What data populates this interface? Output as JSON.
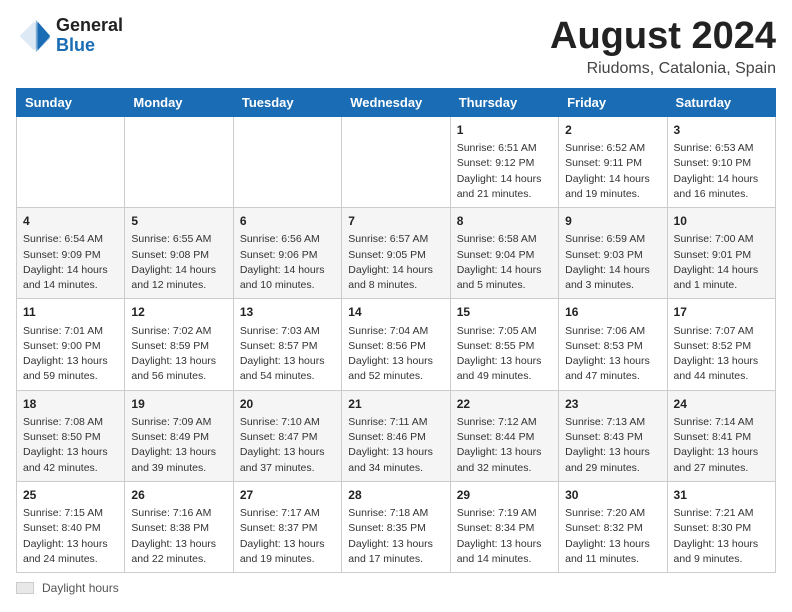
{
  "logo": {
    "general": "General",
    "blue": "Blue"
  },
  "header": {
    "month": "August 2024",
    "location": "Riudoms, Catalonia, Spain"
  },
  "weekdays": [
    "Sunday",
    "Monday",
    "Tuesday",
    "Wednesday",
    "Thursday",
    "Friday",
    "Saturday"
  ],
  "weeks": [
    [
      {
        "day": "",
        "info": ""
      },
      {
        "day": "",
        "info": ""
      },
      {
        "day": "",
        "info": ""
      },
      {
        "day": "",
        "info": ""
      },
      {
        "day": "1",
        "info": "Sunrise: 6:51 AM\nSunset: 9:12 PM\nDaylight: 14 hours and 21 minutes."
      },
      {
        "day": "2",
        "info": "Sunrise: 6:52 AM\nSunset: 9:11 PM\nDaylight: 14 hours and 19 minutes."
      },
      {
        "day": "3",
        "info": "Sunrise: 6:53 AM\nSunset: 9:10 PM\nDaylight: 14 hours and 16 minutes."
      }
    ],
    [
      {
        "day": "4",
        "info": "Sunrise: 6:54 AM\nSunset: 9:09 PM\nDaylight: 14 hours and 14 minutes."
      },
      {
        "day": "5",
        "info": "Sunrise: 6:55 AM\nSunset: 9:08 PM\nDaylight: 14 hours and 12 minutes."
      },
      {
        "day": "6",
        "info": "Sunrise: 6:56 AM\nSunset: 9:06 PM\nDaylight: 14 hours and 10 minutes."
      },
      {
        "day": "7",
        "info": "Sunrise: 6:57 AM\nSunset: 9:05 PM\nDaylight: 14 hours and 8 minutes."
      },
      {
        "day": "8",
        "info": "Sunrise: 6:58 AM\nSunset: 9:04 PM\nDaylight: 14 hours and 5 minutes."
      },
      {
        "day": "9",
        "info": "Sunrise: 6:59 AM\nSunset: 9:03 PM\nDaylight: 14 hours and 3 minutes."
      },
      {
        "day": "10",
        "info": "Sunrise: 7:00 AM\nSunset: 9:01 PM\nDaylight: 14 hours and 1 minute."
      }
    ],
    [
      {
        "day": "11",
        "info": "Sunrise: 7:01 AM\nSunset: 9:00 PM\nDaylight: 13 hours and 59 minutes."
      },
      {
        "day": "12",
        "info": "Sunrise: 7:02 AM\nSunset: 8:59 PM\nDaylight: 13 hours and 56 minutes."
      },
      {
        "day": "13",
        "info": "Sunrise: 7:03 AM\nSunset: 8:57 PM\nDaylight: 13 hours and 54 minutes."
      },
      {
        "day": "14",
        "info": "Sunrise: 7:04 AM\nSunset: 8:56 PM\nDaylight: 13 hours and 52 minutes."
      },
      {
        "day": "15",
        "info": "Sunrise: 7:05 AM\nSunset: 8:55 PM\nDaylight: 13 hours and 49 minutes."
      },
      {
        "day": "16",
        "info": "Sunrise: 7:06 AM\nSunset: 8:53 PM\nDaylight: 13 hours and 47 minutes."
      },
      {
        "day": "17",
        "info": "Sunrise: 7:07 AM\nSunset: 8:52 PM\nDaylight: 13 hours and 44 minutes."
      }
    ],
    [
      {
        "day": "18",
        "info": "Sunrise: 7:08 AM\nSunset: 8:50 PM\nDaylight: 13 hours and 42 minutes."
      },
      {
        "day": "19",
        "info": "Sunrise: 7:09 AM\nSunset: 8:49 PM\nDaylight: 13 hours and 39 minutes."
      },
      {
        "day": "20",
        "info": "Sunrise: 7:10 AM\nSunset: 8:47 PM\nDaylight: 13 hours and 37 minutes."
      },
      {
        "day": "21",
        "info": "Sunrise: 7:11 AM\nSunset: 8:46 PM\nDaylight: 13 hours and 34 minutes."
      },
      {
        "day": "22",
        "info": "Sunrise: 7:12 AM\nSunset: 8:44 PM\nDaylight: 13 hours and 32 minutes."
      },
      {
        "day": "23",
        "info": "Sunrise: 7:13 AM\nSunset: 8:43 PM\nDaylight: 13 hours and 29 minutes."
      },
      {
        "day": "24",
        "info": "Sunrise: 7:14 AM\nSunset: 8:41 PM\nDaylight: 13 hours and 27 minutes."
      }
    ],
    [
      {
        "day": "25",
        "info": "Sunrise: 7:15 AM\nSunset: 8:40 PM\nDaylight: 13 hours and 24 minutes."
      },
      {
        "day": "26",
        "info": "Sunrise: 7:16 AM\nSunset: 8:38 PM\nDaylight: 13 hours and 22 minutes."
      },
      {
        "day": "27",
        "info": "Sunrise: 7:17 AM\nSunset: 8:37 PM\nDaylight: 13 hours and 19 minutes."
      },
      {
        "day": "28",
        "info": "Sunrise: 7:18 AM\nSunset: 8:35 PM\nDaylight: 13 hours and 17 minutes."
      },
      {
        "day": "29",
        "info": "Sunrise: 7:19 AM\nSunset: 8:34 PM\nDaylight: 13 hours and 14 minutes."
      },
      {
        "day": "30",
        "info": "Sunrise: 7:20 AM\nSunset: 8:32 PM\nDaylight: 13 hours and 11 minutes."
      },
      {
        "day": "31",
        "info": "Sunrise: 7:21 AM\nSunset: 8:30 PM\nDaylight: 13 hours and 9 minutes."
      }
    ]
  ],
  "footer": {
    "box_label": "Daylight hours"
  }
}
